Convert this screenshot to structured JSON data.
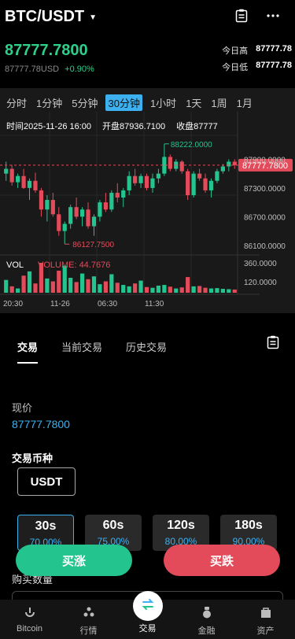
{
  "header": {
    "pair": "BTC/USDT"
  },
  "ticker": {
    "price": "87777.7800",
    "usd_value": "87777.78USD",
    "change": "+0.90%",
    "high_label": "今日高",
    "high_value": "87777.78",
    "low_label": "今日低",
    "low_value": "87777.78"
  },
  "timeframes": [
    "分时",
    "1分钟",
    "5分钟",
    "30分钟",
    "1小时",
    "1天",
    "1周",
    "1月"
  ],
  "active_timeframe": "30分钟",
  "ohlc": {
    "time": "时间2025-11-26 16:00",
    "open": "开盘87936.7100",
    "close": "收盘87777"
  },
  "chart_data": {
    "type": "candlestick",
    "y_ticks": [
      "87900.0000",
      "87300.0000",
      "86700.0000",
      "86100.0000"
    ],
    "x_ticks": [
      "20:30",
      "11-26",
      "06:30",
      "11:30"
    ],
    "max_label": "88222.0000",
    "min_label": "86127.7500",
    "last_price_label": "87777.7800",
    "volume_label": "VOL",
    "volume_value_label": "VOLUME: 44.7676",
    "volume_ticks": [
      "360.0000",
      "120.0000"
    ],
    "ylim": [
      85900,
      88400
    ],
    "candles": [
      [
        87600,
        87850,
        87450,
        87700
      ],
      [
        87700,
        87780,
        87350,
        87420
      ],
      [
        87420,
        87600,
        87300,
        87550
      ],
      [
        87550,
        87700,
        87280,
        87300
      ],
      [
        87300,
        87500,
        87050,
        87450
      ],
      [
        87450,
        87620,
        87200,
        87250
      ],
      [
        87250,
        87300,
        86700,
        86850
      ],
      [
        86850,
        87150,
        86600,
        87050
      ],
      [
        87050,
        87200,
        86700,
        86750
      ],
      [
        86750,
        86900,
        86300,
        86400
      ],
      [
        86400,
        86600,
        86127,
        86550
      ],
      [
        86550,
        86950,
        86450,
        86900
      ],
      [
        86900,
        87100,
        86650,
        86700
      ],
      [
        86700,
        86900,
        86500,
        86850
      ],
      [
        86850,
        87000,
        86450,
        86500
      ],
      [
        86500,
        86750,
        86300,
        86700
      ],
      [
        86700,
        87050,
        86600,
        87000
      ],
      [
        87000,
        87200,
        86800,
        86850
      ],
      [
        86850,
        87250,
        86800,
        87200
      ],
      [
        87200,
        87400,
        87000,
        87100
      ],
      [
        87100,
        87300,
        86900,
        87250
      ],
      [
        87250,
        87650,
        87150,
        87550
      ],
      [
        87550,
        87700,
        87350,
        87400
      ],
      [
        87400,
        87600,
        87300,
        87550
      ],
      [
        87550,
        87600,
        87250,
        87300
      ],
      [
        87300,
        87600,
        87200,
        87500
      ],
      [
        87500,
        87700,
        87400,
        87600
      ],
      [
        87600,
        88222,
        87550,
        87950
      ],
      [
        87950,
        88000,
        87650,
        87700
      ],
      [
        87700,
        87900,
        87650,
        87850
      ],
      [
        87850,
        87880,
        87600,
        87650
      ],
      [
        87650,
        87700,
        87050,
        87150
      ],
      [
        87150,
        87650,
        87100,
        87600
      ],
      [
        87600,
        87700,
        87450,
        87500
      ],
      [
        87500,
        87600,
        87200,
        87250
      ],
      [
        87250,
        87500,
        87100,
        87450
      ],
      [
        87450,
        87700,
        87400,
        87650
      ],
      [
        87650,
        87800,
        87600,
        87750
      ],
      [
        87750,
        87900,
        87650,
        87850
      ],
      [
        87850,
        87900,
        87700,
        87777
      ]
    ],
    "volumes": [
      180,
      90,
      60,
      240,
      300,
      130,
      420,
      200,
      160,
      310,
      380,
      210,
      150,
      270,
      190,
      230,
      120,
      160,
      260,
      140,
      110,
      90,
      130,
      170,
      80,
      70,
      100,
      110,
      85,
      60,
      75,
      220,
      90,
      95,
      70,
      60,
      65,
      55,
      50,
      45
    ]
  },
  "trade_tabs": [
    "交易",
    "当前交易",
    "历史交易"
  ],
  "form": {
    "current_price_label": "现价",
    "current_price": "87777.7800",
    "coin_label": "交易币种",
    "coin": "USDT",
    "quantity_label": "购买数量"
  },
  "durations": [
    {
      "time": "30s",
      "rate": "70.00%"
    },
    {
      "time": "60s",
      "rate": "75.00%"
    },
    {
      "time": "120s",
      "rate": "80.00%"
    },
    {
      "time": "180s",
      "rate": "90.00%"
    }
  ],
  "actions": {
    "buy_up": "买涨",
    "buy_down": "买跌"
  },
  "nav": [
    "Bitcoin",
    "行情",
    "交易",
    "金融",
    "资产"
  ],
  "colors": {
    "up": "#23c48e",
    "down": "#e34b5a",
    "accent": "#3db1f0"
  }
}
